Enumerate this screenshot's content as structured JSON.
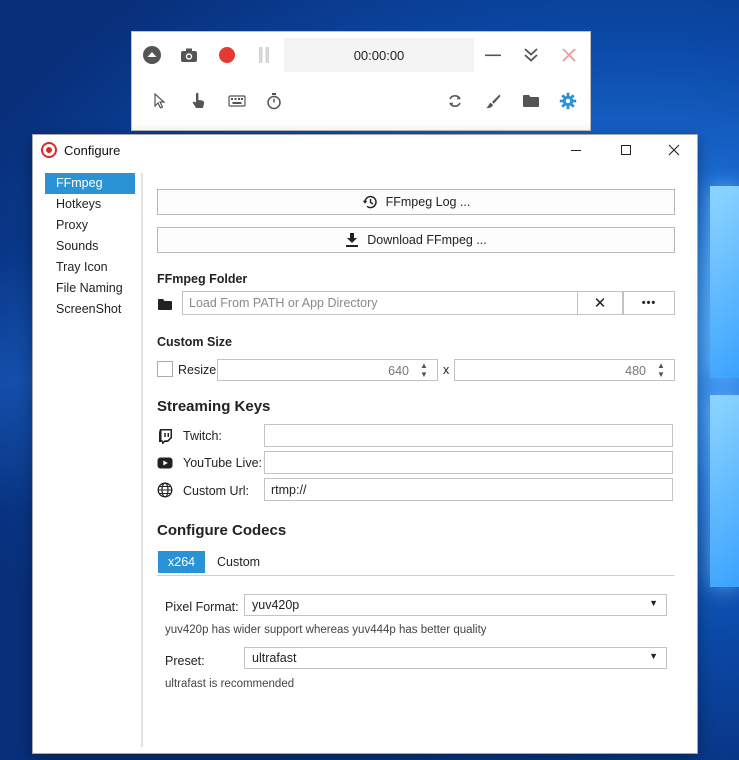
{
  "recorder": {
    "timer": "00:00:00"
  },
  "window": {
    "title": "Configure"
  },
  "sidebar": {
    "items": [
      {
        "label": "FFmpeg"
      },
      {
        "label": "Hotkeys"
      },
      {
        "label": "Proxy"
      },
      {
        "label": "Sounds"
      },
      {
        "label": "Tray Icon"
      },
      {
        "label": "File Naming"
      },
      {
        "label": "ScreenShot"
      }
    ]
  },
  "ffmpeg": {
    "log_button": "FFmpeg Log ...",
    "download_button": "Download FFmpeg ...",
    "folder_label": "FFmpeg Folder",
    "folder_placeholder": "Load From PATH or App Directory",
    "clear_glyph": "✕",
    "browse_glyph": "•••"
  },
  "custom_size": {
    "label": "Custom Size",
    "resize_label": "Resize",
    "width": "640",
    "separator": "x",
    "height": "480"
  },
  "streaming": {
    "title": "Streaming Keys",
    "twitch_label": "Twitch:",
    "twitch_value": "",
    "youtube_label": "YouTube Live:",
    "youtube_value": "",
    "custom_label": "Custom Url:",
    "custom_value": "rtmp://"
  },
  "codecs": {
    "title": "Configure Codecs",
    "tabs": [
      {
        "label": "x264"
      },
      {
        "label": "Custom"
      }
    ],
    "pixel_format_label": "Pixel Format:",
    "pixel_format_value": "yuv420p",
    "pixel_format_hint": "yuv420p has wider support whereas yuv444p has better quality",
    "preset_label": "Preset:",
    "preset_value": "ultrafast",
    "preset_hint": "ultrafast is recommended"
  },
  "colors": {
    "accent": "#2a93d5",
    "record": "#e53935",
    "close_faded": "#f19a9a"
  }
}
